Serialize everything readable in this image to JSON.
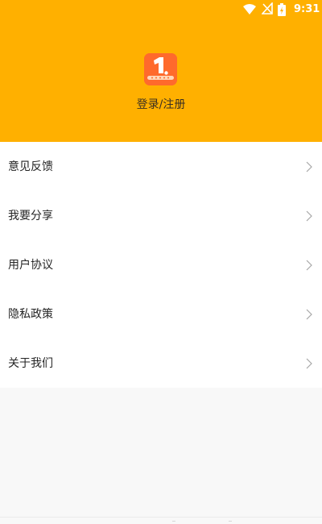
{
  "status_bar": {
    "time": "9:31",
    "wifi_icon": "wifi-icon",
    "signal_icon": "signal-off-icon",
    "battery_icon": "battery-charging-icon"
  },
  "profile": {
    "logo_icon": "app-logo-icon",
    "login_label": "登录/注册"
  },
  "menu": {
    "items": [
      {
        "label": "意见反馈",
        "icon": "chevron-right-icon"
      },
      {
        "label": "我要分享",
        "icon": "chevron-right-icon"
      },
      {
        "label": "用户协议",
        "icon": "chevron-right-icon"
      },
      {
        "label": "隐私政策",
        "icon": "chevron-right-icon"
      },
      {
        "label": "关于我们",
        "icon": "chevron-right-icon"
      }
    ]
  },
  "colors": {
    "header_bg": "#ffb000",
    "page_bg": "#f8f8f8",
    "menu_bg": "#ffffff",
    "logo_bg": "#ff6a2c",
    "text": "#252525"
  }
}
